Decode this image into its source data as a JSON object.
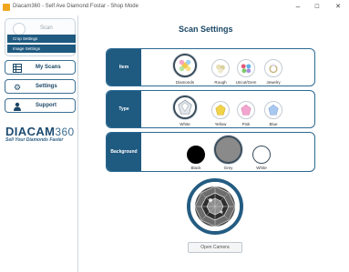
{
  "window": {
    "title": "Diacam360 - Self Ave Diamond Fostar - Shop Mode",
    "minimize": "–",
    "maximize": "☐",
    "close": "✕"
  },
  "sidebar": {
    "scan_label": "Scan",
    "sub_items": [
      "Crop Settings",
      "Image Settings"
    ],
    "nav": [
      {
        "label": "My Scans",
        "icon": "grid-icon"
      },
      {
        "label": "Settings",
        "icon": "gears-icon"
      },
      {
        "label": "Support",
        "icon": "person-icon"
      }
    ],
    "logo_text": "DIACAM",
    "logo_number": "360",
    "logo_tagline": "Sell Your Diamonds Faster"
  },
  "main": {
    "title": "Scan Settings",
    "panels": [
      {
        "label": "Item",
        "options": [
          {
            "label": "Diamonds",
            "selected": true,
            "color": "#f2c94c"
          },
          {
            "label": "Rough",
            "selected": false,
            "color": "#e4e0c8"
          },
          {
            "label": "Uncut/Gem",
            "selected": false,
            "color": "#8cc6e8"
          },
          {
            "label": "Jewelry",
            "selected": false,
            "color": "#e8e2d2"
          }
        ]
      },
      {
        "label": "Type",
        "options": [
          {
            "label": "White",
            "selected": true,
            "color": "#d8dde2"
          },
          {
            "label": "Yellow",
            "selected": false,
            "color": "#f1d34a"
          },
          {
            "label": "Pink",
            "selected": false,
            "color": "#f2a6cf"
          },
          {
            "label": "Blue",
            "selected": false,
            "color": "#a9c8f0"
          }
        ]
      },
      {
        "label": "Background",
        "options": [
          {
            "label": "Black",
            "selected": false,
            "color": "#000000"
          },
          {
            "label": "Grey",
            "selected": true,
            "color": "#8a8a8a"
          },
          {
            "label": "White",
            "selected": false,
            "color": "#ffffff"
          }
        ]
      }
    ],
    "open_camera_label": "Open Camera"
  }
}
